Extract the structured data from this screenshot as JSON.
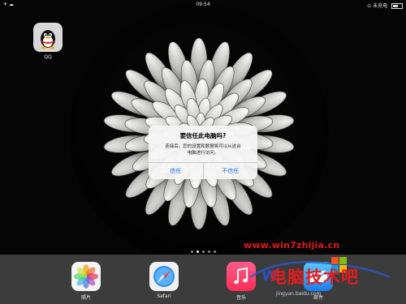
{
  "status_bar": {
    "left": "✈ ☁",
    "time": "09:54",
    "right": "⊙ 未充电"
  },
  "apps": [
    {
      "label": "QQ",
      "icon": "qq-penguin-icon"
    }
  ],
  "alert": {
    "title": "要信任此电脑吗?",
    "message_line1": "连接后，您的设置和数据将可以从这台",
    "message_line2": "电脑进行访问。",
    "trust_label": "信任",
    "dont_trust_label": "不信任"
  },
  "page_indicator": {
    "count": 5,
    "active": 1
  },
  "dock": [
    {
      "label": "照片",
      "icon": "photos-icon"
    },
    {
      "label": "Safari",
      "icon": "safari-icon"
    },
    {
      "label": "音乐",
      "icon": "music-icon"
    },
    {
      "label": "邮件",
      "icon": "mail-icon"
    }
  ],
  "watermark": {
    "url": "www.win7zhijia.cn",
    "big_text": "电脑技术吧",
    "sub_text": "jingyan.baidu.com"
  },
  "colors": {
    "alert_button": "#1a6ee6",
    "watermark_red": "#e31c1c",
    "background": "#050505"
  }
}
